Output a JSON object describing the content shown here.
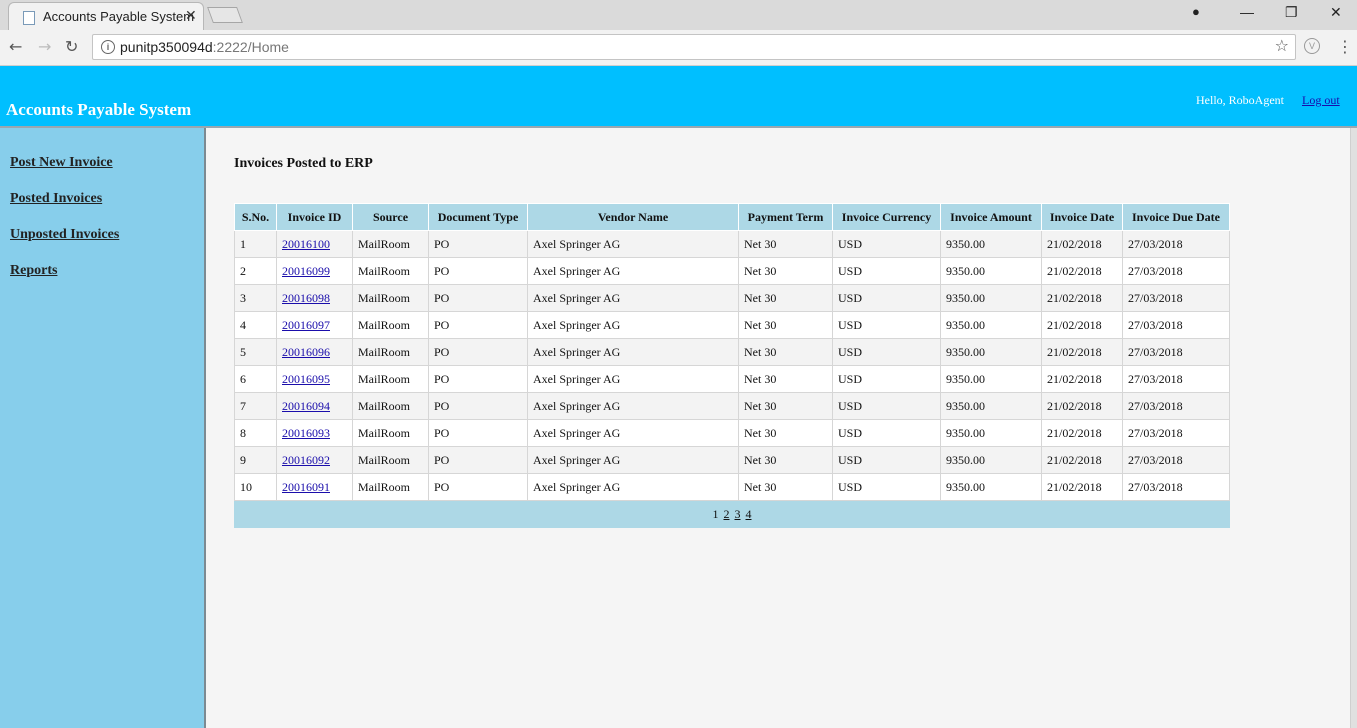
{
  "browser": {
    "tab_title": "Accounts Payable System",
    "tab_close": "✕",
    "url_host": "punitp350094d",
    "url_path": ":2222/Home",
    "ctrl_account": "●",
    "ctrl_minimize": "—",
    "ctrl_maximize": "❐",
    "ctrl_close": "✕",
    "back": "←",
    "forward": "→",
    "reload": "↻",
    "star": "☆",
    "menu": "⋮",
    "info": "i",
    "ext": "V"
  },
  "header": {
    "title": "Accounts Payable System",
    "greeting": "Hello, RoboAgent",
    "logout": "Log out"
  },
  "sidebar": {
    "items": [
      {
        "label": "Post New Invoice"
      },
      {
        "label": "Posted Invoices"
      },
      {
        "label": "Unposted Invoices"
      },
      {
        "label": "Reports"
      }
    ]
  },
  "main": {
    "title": "Invoices Posted to ERP",
    "columns": [
      "S.No.",
      "Invoice ID",
      "Source",
      "Document Type",
      "Vendor Name",
      "Payment Term",
      "Invoice Currency",
      "Invoice Amount",
      "Invoice Date",
      "Invoice Due Date"
    ],
    "rows": [
      {
        "sno": "1",
        "id": "20016100",
        "source": "MailRoom",
        "doctype": "PO",
        "vendor": "Axel Springer AG",
        "term": "Net 30",
        "currency": "USD",
        "amount": "9350.00",
        "date": "21/02/2018",
        "due": "27/03/2018"
      },
      {
        "sno": "2",
        "id": "20016099",
        "source": "MailRoom",
        "doctype": "PO",
        "vendor": "Axel Springer AG",
        "term": "Net 30",
        "currency": "USD",
        "amount": "9350.00",
        "date": "21/02/2018",
        "due": "27/03/2018"
      },
      {
        "sno": "3",
        "id": "20016098",
        "source": "MailRoom",
        "doctype": "PO",
        "vendor": "Axel Springer AG",
        "term": "Net 30",
        "currency": "USD",
        "amount": "9350.00",
        "date": "21/02/2018",
        "due": "27/03/2018"
      },
      {
        "sno": "4",
        "id": "20016097",
        "source": "MailRoom",
        "doctype": "PO",
        "vendor": "Axel Springer AG",
        "term": "Net 30",
        "currency": "USD",
        "amount": "9350.00",
        "date": "21/02/2018",
        "due": "27/03/2018"
      },
      {
        "sno": "5",
        "id": "20016096",
        "source": "MailRoom",
        "doctype": "PO",
        "vendor": "Axel Springer AG",
        "term": "Net 30",
        "currency": "USD",
        "amount": "9350.00",
        "date": "21/02/2018",
        "due": "27/03/2018"
      },
      {
        "sno": "6",
        "id": "20016095",
        "source": "MailRoom",
        "doctype": "PO",
        "vendor": "Axel Springer AG",
        "term": "Net 30",
        "currency": "USD",
        "amount": "9350.00",
        "date": "21/02/2018",
        "due": "27/03/2018"
      },
      {
        "sno": "7",
        "id": "20016094",
        "source": "MailRoom",
        "doctype": "PO",
        "vendor": "Axel Springer AG",
        "term": "Net 30",
        "currency": "USD",
        "amount": "9350.00",
        "date": "21/02/2018",
        "due": "27/03/2018"
      },
      {
        "sno": "8",
        "id": "20016093",
        "source": "MailRoom",
        "doctype": "PO",
        "vendor": "Axel Springer AG",
        "term": "Net 30",
        "currency": "USD",
        "amount": "9350.00",
        "date": "21/02/2018",
        "due": "27/03/2018"
      },
      {
        "sno": "9",
        "id": "20016092",
        "source": "MailRoom",
        "doctype": "PO",
        "vendor": "Axel Springer AG",
        "term": "Net 30",
        "currency": "USD",
        "amount": "9350.00",
        "date": "21/02/2018",
        "due": "27/03/2018"
      },
      {
        "sno": "10",
        "id": "20016091",
        "source": "MailRoom",
        "doctype": "PO",
        "vendor": "Axel Springer AG",
        "term": "Net 30",
        "currency": "USD",
        "amount": "9350.00",
        "date": "21/02/2018",
        "due": "27/03/2018"
      }
    ],
    "pager": {
      "current": "1",
      "pages": [
        "2",
        "3",
        "4"
      ]
    }
  },
  "colors": {
    "header_bg": "#00bfff",
    "sidebar_bg": "#87ceeb",
    "table_header_bg": "#add8e6",
    "link": "#1a0dab"
  }
}
